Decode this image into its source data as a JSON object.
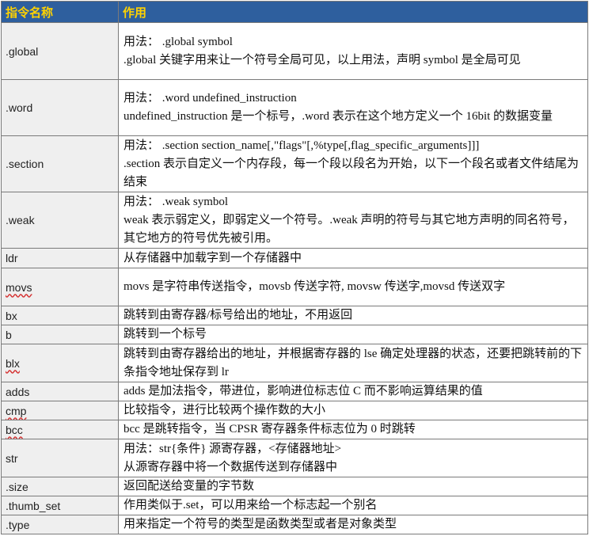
{
  "header": {
    "col1": "指令名称",
    "col2": "作用"
  },
  "rows": [
    {
      "cmd": ".global",
      "lines": [
        "用法： .global symbol",
        ".global 关键字用来让一个符号全局可见，以上用法，声明 symbol 是全局可见"
      ]
    },
    {
      "cmd": ".word",
      "lines": [
        "用法： .word    undefined_instruction",
        "undefined_instruction 是一个标号，.word 表示在这个地方定义一个 16bit 的数据变量"
      ]
    },
    {
      "cmd": ".section",
      "lines": [
        "用法： .section section_name[,\"flags\"[,%type[,flag_specific_arguments]]]",
        ".section 表示自定义一个内存段，每一个段以段名为开始，以下一个段名或者文件结尾为结束"
      ]
    },
    {
      "cmd": ".weak",
      "lines": [
        "用法： .weak symbol",
        "weak 表示弱定义，即弱定义一个符号。.weak 声明的符号与其它地方声明的同名符号，其它地方的符号优先被引用。"
      ]
    },
    {
      "cmd": "ldr",
      "lines": [
        "从存储器中加载字到一个存储器中"
      ]
    },
    {
      "cmd": "movs",
      "lines": [
        "movs 是字符串传送指令，movsb 传送字符, movsw 传送字,movsd 传送双字"
      ]
    },
    {
      "cmd": "bx",
      "lines": [
        "跳转到由寄存器/标号给出的地址，不用返回"
      ]
    },
    {
      "cmd": "b",
      "lines": [
        "跳转到一个标号"
      ]
    },
    {
      "cmd": "blx",
      "lines": [
        "跳转到由寄存器给出的地址，并根据寄存器的 lse 确定处理器的状态，还要把跳转前的下条指令地址保存到 lr"
      ]
    },
    {
      "cmd": "adds",
      "lines": [
        "adds 是加法指令，带进位，影响进位标志位 C 而不影响运算结果的值"
      ]
    },
    {
      "cmd": "cmp",
      "lines": [
        "比较指令，进行比较两个操作数的大小"
      ]
    },
    {
      "cmd": "bcc",
      "lines": [
        "bcc 是跳转指令，当 CPSR 寄存器条件标志位为 0 时跳转"
      ]
    },
    {
      "cmd": "str",
      "lines": [
        "用法：str{条件}   源寄存器，<存储器地址>",
        "从源寄存器中将一个数据传送到存储器中"
      ]
    },
    {
      "cmd": ".size",
      "lines": [
        "返回配送给变量的字节数"
      ]
    },
    {
      "cmd": ".thumb_set",
      "lines": [
        "作用类似于.set，可以用来给一个标志起一个别名"
      ]
    },
    {
      "cmd": ".type",
      "lines": [
        "用来指定一个符号的类型是函数类型或者是对象类型"
      ]
    }
  ]
}
